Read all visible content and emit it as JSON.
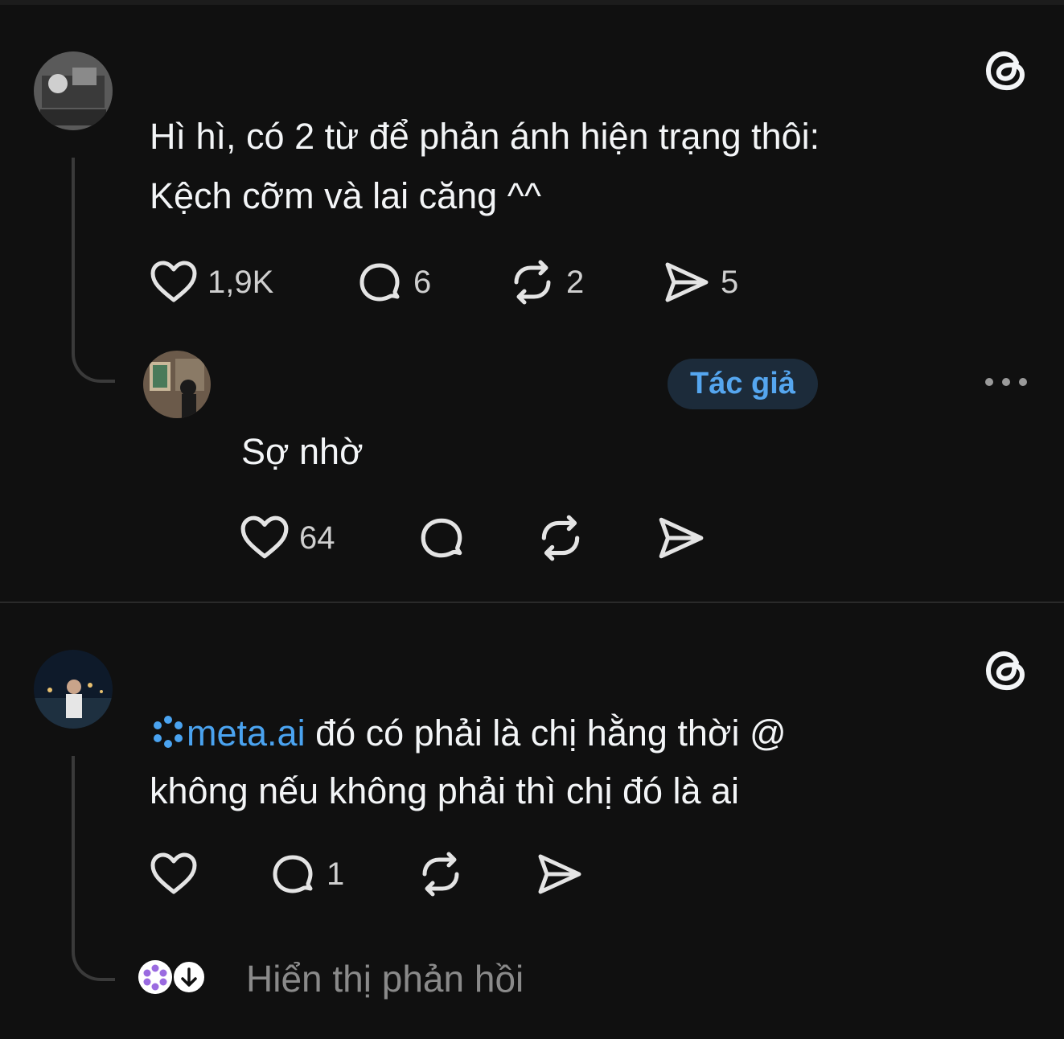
{
  "post1": {
    "username": "",
    "text_line1": "Hì hì, có 2 từ để phản ánh hiện trạng thôi:",
    "text_line2": "Kệch cỡm và lai căng ^^",
    "likes": "1,9K",
    "replies": "6",
    "reposts": "2",
    "shares": "5"
  },
  "reply1": {
    "username": "",
    "timestamp": "",
    "author_badge": "Tác giả",
    "text": "Sợ nhờ",
    "likes": "64"
  },
  "post2": {
    "username": "",
    "mention": "meta.ai",
    "text_line1_rest": " đó có phải là chị hằng thời @",
    "text_line2": "không nếu không phải thì chị đó là ai",
    "replies": "1",
    "show_replies_label": "Hiển thị phản hồi"
  },
  "colors": {
    "background": "#101010",
    "text": "#f3f5f7",
    "accent": "#4aa3f0",
    "muted": "#8a8a8a"
  },
  "icons": [
    "threads-logo-icon",
    "heart-icon",
    "comment-icon",
    "repost-icon",
    "share-icon",
    "more-icon",
    "meta-ai-icon",
    "arrow-down-icon"
  ]
}
